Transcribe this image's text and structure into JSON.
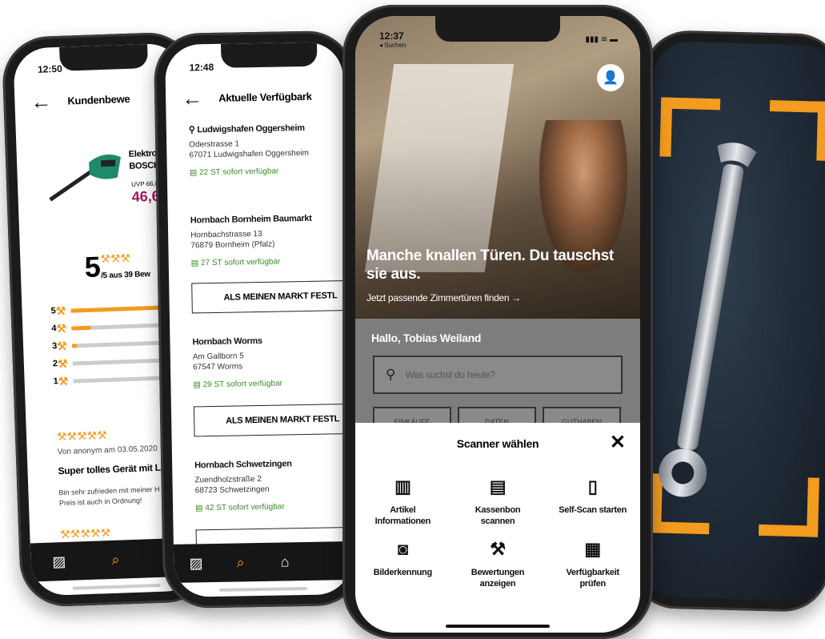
{
  "phone1": {
    "time": "12:50",
    "header_title": "Kundenbewe",
    "product_line1": "Elektro",
    "product_line2": "BOSCH",
    "uvp": "UVP 66,8",
    "price": "46,6",
    "rating_big": "5",
    "rating_sub": "/5 aus 39 Bew",
    "rating_rows": [
      {
        "label": "5",
        "fill": 0.95
      },
      {
        "label": "4",
        "fill": 0.2
      },
      {
        "label": "3",
        "fill": 0.05
      },
      {
        "label": "2",
        "fill": 0
      },
      {
        "label": "1",
        "fill": 0
      }
    ],
    "review_meta": "Von anonym am 03.05.2020",
    "review_title": "Super tolles Gerät mit Leis",
    "review_text1": "Bin sehr zufrieden mit meiner H",
    "review_text2": "Preis ist auch in Ordnung!"
  },
  "phone2": {
    "time": "12:48",
    "header_title": "Aktuelle Verfügbark",
    "stores": [
      {
        "name": "Ludwigshafen Oggersheim",
        "street": "Oderstrasse 1",
        "city": "67071 Ludwigshafen Oggersheim",
        "avail": "22 ST sofort verfügbar"
      },
      {
        "name": "Hornbach Bornheim Baumarkt",
        "street": "Hornbachstrasse 13",
        "city": "76879 Bornheim (Pfalz)",
        "avail": "27 ST sofort verfügbar"
      },
      {
        "name": "Hornbach Worms",
        "street": "Am Gallborn 5",
        "city": "67547 Worms",
        "avail": "29 ST sofort verfügbar"
      },
      {
        "name": "Hornbach Schwetzingen",
        "street": "Zuendholzstraße 2",
        "city": "68723 Schwetzingen",
        "avail": "42 ST sofort verfügbar"
      }
    ],
    "market_button": "ALS MEINEN MARKT FESTL"
  },
  "phone3": {
    "time": "12:37",
    "back_label": "◂ Suchen",
    "hero_text": "Manche knallen Türen. Du tauschst sie aus.",
    "hero_link": "Jetzt passende Zimmertüren finden →",
    "greeting": "Hallo, Tobias Weiland",
    "search_placeholder": "Was suchst du heute?",
    "quick_buttons": [
      "EINKÄUFE",
      "DATEN",
      "GUTHABEN"
    ],
    "sheet_title": "Scanner wählen",
    "options": [
      {
        "icon": "barcode-icon",
        "line1": "Artikel",
        "line2": "Informationen"
      },
      {
        "icon": "receipt-icon",
        "line1": "Kassenbon",
        "line2": "scannen"
      },
      {
        "icon": "self-scan-icon",
        "line1": "Self-Scan starten",
        "line2": ""
      },
      {
        "icon": "camera-icon",
        "line1": "Bilderkennung",
        "line2": ""
      },
      {
        "icon": "hammer-icon",
        "line1": "Bewertungen",
        "line2": "anzeigen"
      },
      {
        "icon": "pallet-icon",
        "line1": "Verfügbarkeit",
        "line2": "prüfen"
      }
    ]
  },
  "colors": {
    "accent": "#f39c1f",
    "available": "#3a8a2a",
    "nav_bg": "#161616"
  }
}
